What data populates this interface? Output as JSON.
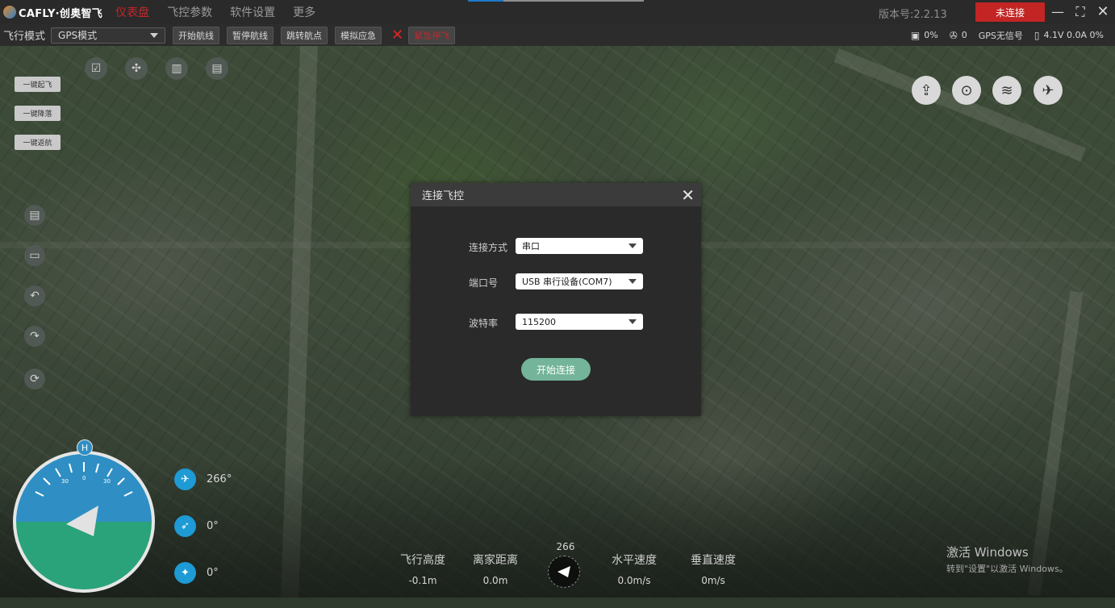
{
  "app": {
    "logo_text": "CAFLY·创奥智飞",
    "menu": [
      "仪表盘",
      "飞控参数",
      "软件设置",
      "更多"
    ],
    "active_menu_index": 0,
    "version": "版本号:2.2.13",
    "connection_status": "未连接",
    "progress_fraction": 0.2
  },
  "toolbar": {
    "mode_label": "飞行模式",
    "mode_value": "GPS模式",
    "buttons": [
      "开始航线",
      "暂停航线",
      "跳转航点",
      "模拟应急"
    ],
    "abort_label": "紧急停飞",
    "status": {
      "battery_percent": "0%",
      "satellites": "0",
      "gps": "GPS无信号",
      "voltage": "4.1V 0.0A 0%"
    }
  },
  "quick_actions": [
    "一键起飞",
    "一键降落",
    "一键返航"
  ],
  "dialog": {
    "title": "连接飞控",
    "fields": [
      {
        "label": "连接方式",
        "value": "串口"
      },
      {
        "label": "端口号",
        "value": "USB 串行设备(COM7)"
      },
      {
        "label": "波特率",
        "value": "115200"
      }
    ],
    "connect_button": "开始连接"
  },
  "attitude": {
    "home_marker": "H",
    "heading": "266°",
    "pitch": "0°",
    "roll": "0°",
    "scale_labels": [
      "30",
      "0",
      "30"
    ]
  },
  "telemetry": {
    "altitude_label": "飞行高度",
    "altitude_value": "-0.1m",
    "distance_label": "离家距离",
    "distance_value": "0.0m",
    "heading_value": "266",
    "hspeed_label": "水平速度",
    "hspeed_value": "0.0m/s",
    "vspeed_label": "垂直速度",
    "vspeed_value": "0m/s"
  },
  "watermark": {
    "title": "激活 Windows",
    "subtitle": "转到\"设置\"以激活 Windows。"
  },
  "colors": {
    "accent_red": "#c22524",
    "connect_green": "#73b49a",
    "sky": "#2f8fc4",
    "ground": "#2aa37a"
  }
}
